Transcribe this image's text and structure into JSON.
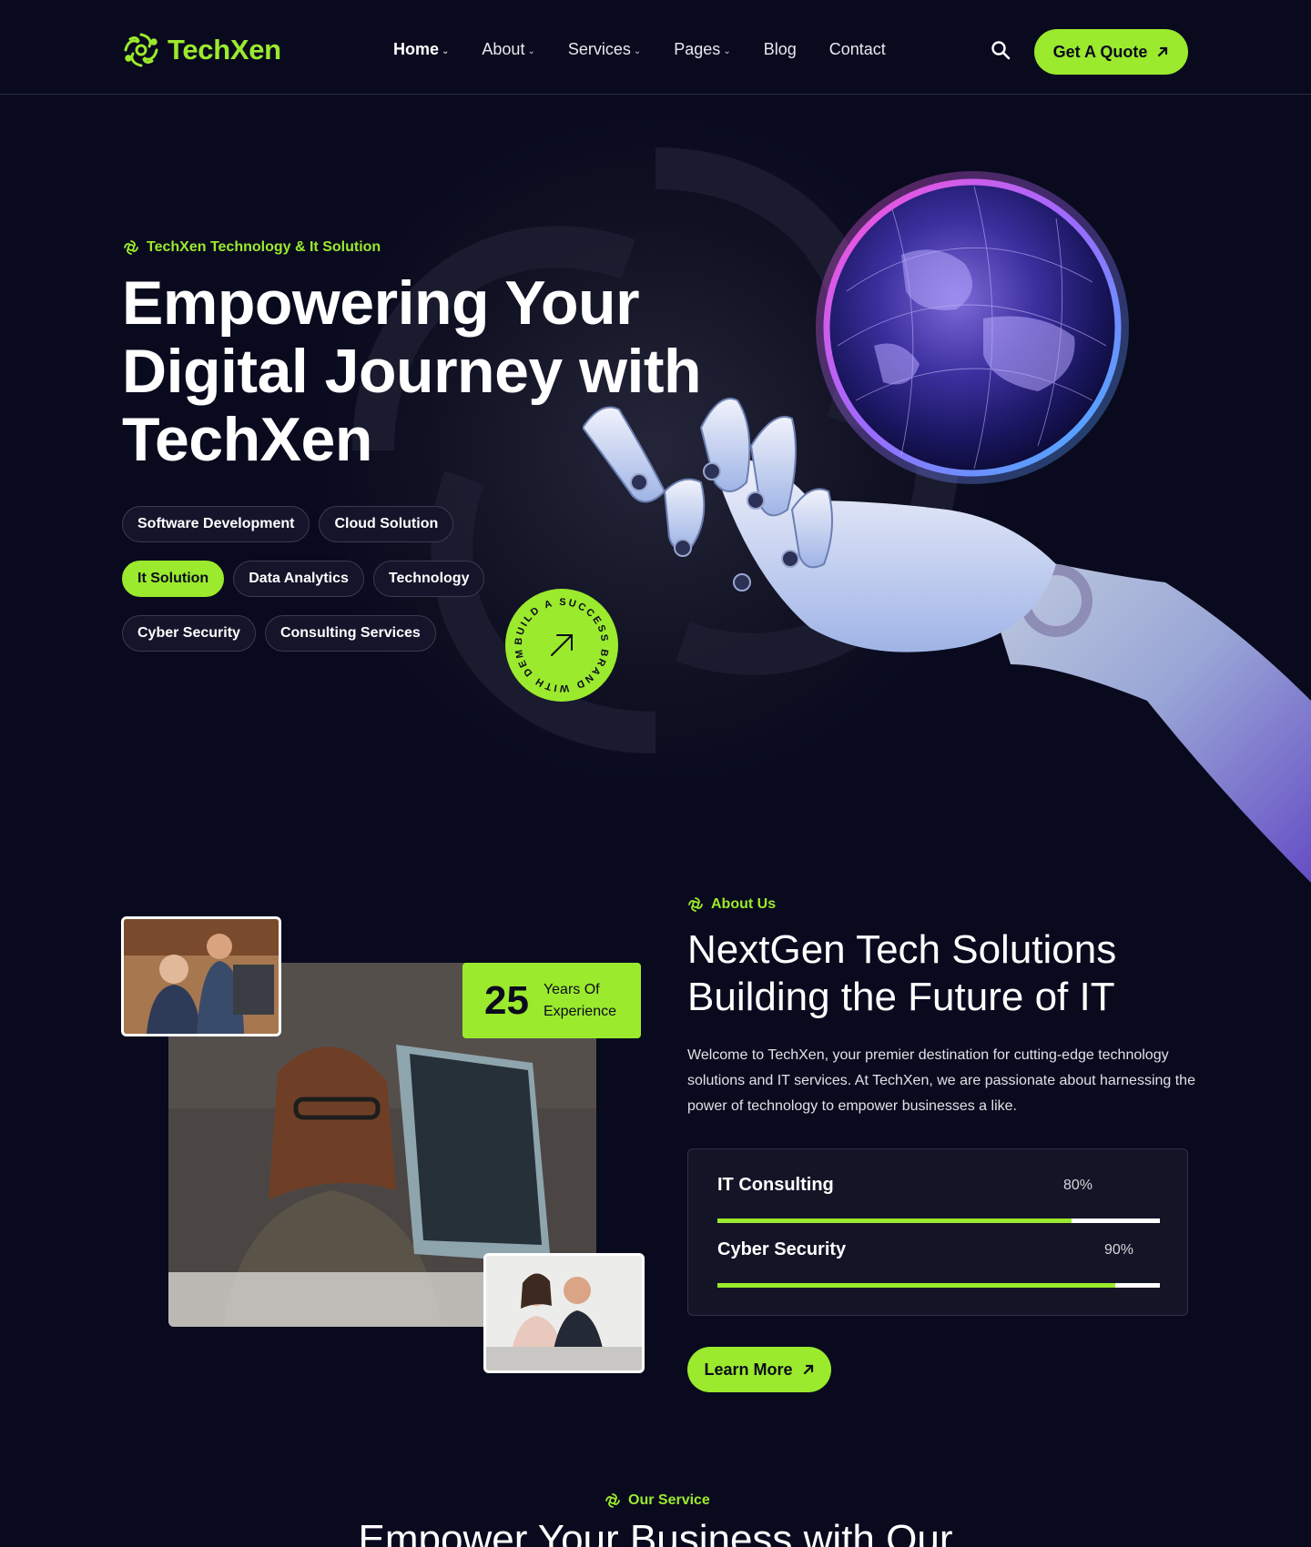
{
  "header": {
    "brand": "TechXen",
    "nav": [
      {
        "label": "Home",
        "dropdown": true,
        "active": true
      },
      {
        "label": "About",
        "dropdown": true,
        "active": false
      },
      {
        "label": "Services",
        "dropdown": true,
        "active": false
      },
      {
        "label": "Pages",
        "dropdown": true,
        "active": false
      },
      {
        "label": "Blog",
        "dropdown": false,
        "active": false
      },
      {
        "label": "Contact",
        "dropdown": false,
        "active": false
      }
    ],
    "search_icon": "search-icon",
    "cta_label": "Get A Quote",
    "cta_icon": "arrow-up-right-icon"
  },
  "hero": {
    "tagline": "TechXen Technology & It Solution",
    "title_line1": "Empowering Your",
    "title_line2": "Digital Journey with",
    "title_line3": "TechXen",
    "chips": [
      [
        {
          "label": "Software Development",
          "selected": false
        },
        {
          "label": "Cloud Solution",
          "selected": false
        }
      ],
      [
        {
          "label": "It Solution",
          "selected": true
        },
        {
          "label": "Data Analytics",
          "selected": false
        },
        {
          "label": "Technology",
          "selected": false
        }
      ],
      [
        {
          "label": "Cyber Security",
          "selected": false
        },
        {
          "label": "Consulting Services",
          "selected": false
        }
      ]
    ],
    "badge_text": "BUILD A SUCCESS BRAND WITH DEMOUI"
  },
  "about": {
    "tagline": "About Us",
    "title_line1": "NextGen Tech Solutions",
    "title_line2": "Building the Future of IT",
    "description": "Welcome to TechXen, your premier destination for cutting-edge technology solutions and IT services. At TechXen, we are passionate about harnessing the power of technology to empower businesses a like.",
    "experience_number": "25",
    "experience_line1": "Years Of",
    "experience_line2": "Experience",
    "skills": [
      {
        "name": "IT Consulting",
        "percent_label": "80%",
        "percent": 80
      },
      {
        "name": "Cyber Security",
        "percent_label": "90%",
        "percent": 90
      }
    ],
    "cta_label": "Learn More"
  },
  "services": {
    "tagline": "Our Service",
    "title": "Empower Your Business with Our"
  },
  "colors": {
    "accent": "#9bea2d",
    "background": "#090a1e",
    "card": "#141427"
  }
}
